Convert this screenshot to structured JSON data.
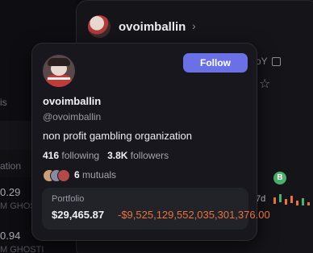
{
  "background": {
    "left_list": {
      "item1_text": "is",
      "item2_text": "ation",
      "row1_value": "0.29",
      "row1_sub": "M GHOSTI",
      "row2_value": "0.94",
      "row2_sub": "M GHOSTI"
    },
    "profile_card": {
      "username": "ovoimballin",
      "handle_fragment": "oY",
      "badge_letter": "B",
      "range_label": "7d"
    }
  },
  "popover": {
    "username": "ovoimballin",
    "handle": "@ovoimballin",
    "bio": "non profit gambling organization",
    "follow_label": "Follow",
    "following_count": "416",
    "following_label": "following",
    "followers_count": "3.8K",
    "followers_label": "followers",
    "mutuals_count": "6",
    "mutuals_label": "mutuals",
    "portfolio": {
      "label": "Portfolio",
      "value": "$29,465.87",
      "change": "-$9,525,129,552,035,301,376.00"
    }
  },
  "colors": {
    "accent": "#6a71e6",
    "negative": "#e8733d",
    "positive": "#4caf6a",
    "background": "#0b0b0f",
    "card": "#17171d"
  },
  "icons": [
    "chevron-right-icon",
    "copy-icon",
    "star-icon",
    "avatar-image"
  ]
}
